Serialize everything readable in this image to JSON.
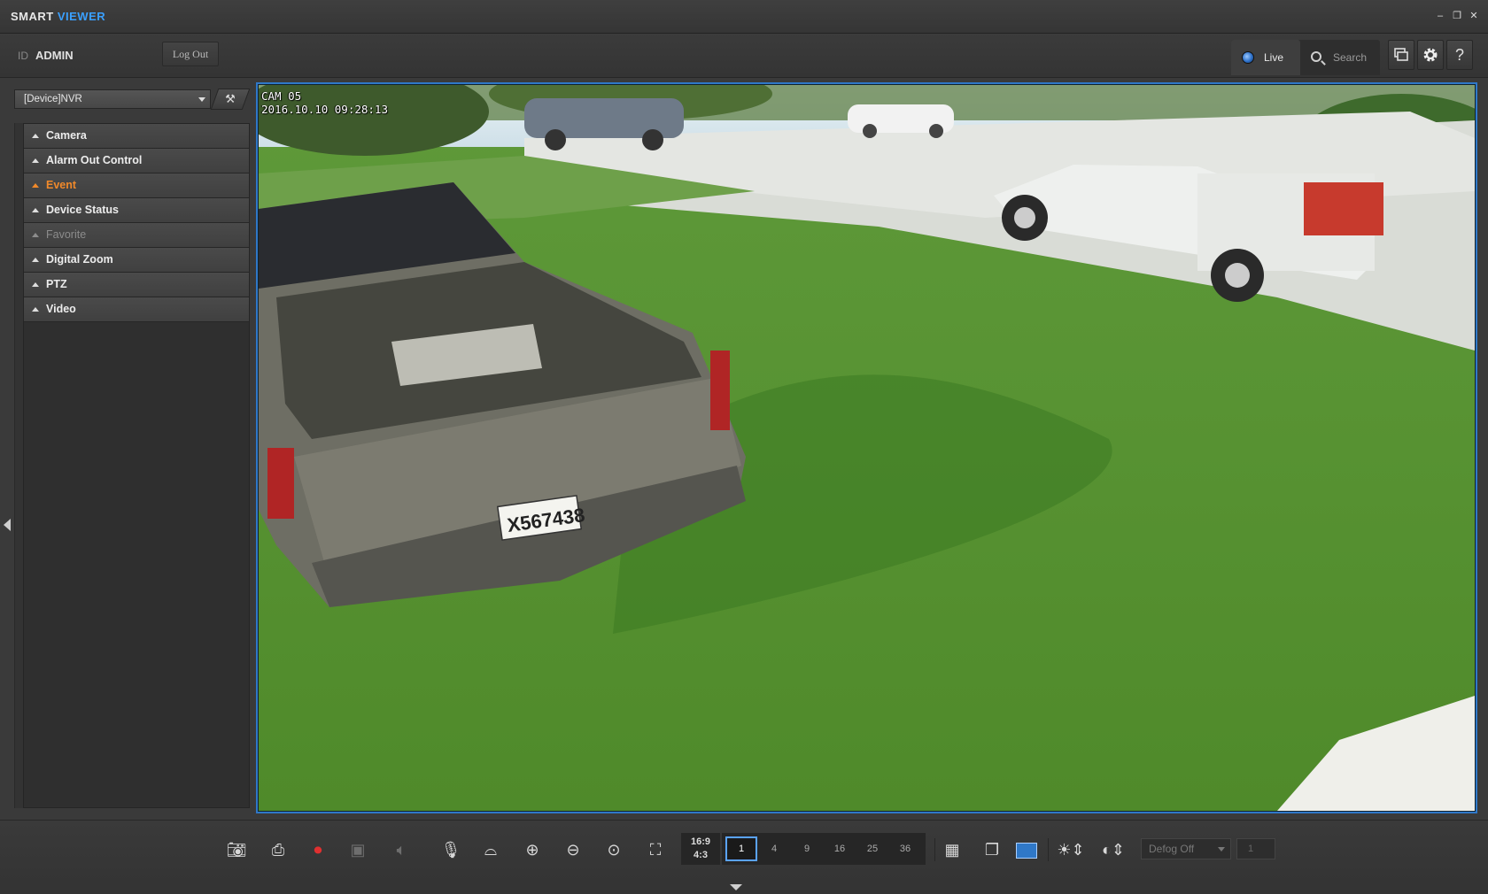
{
  "app": {
    "title_part1": "SMART",
    "title_part2": "VIEWER"
  },
  "window_controls": {
    "minimize": "–",
    "restore": "❐",
    "close": "✕"
  },
  "header": {
    "id_label": "ID",
    "user": "ADMIN",
    "logout_label": "Log Out",
    "tabs": {
      "live": "Live",
      "search": "Search"
    },
    "icons": [
      "display-icon",
      "gear-icon",
      "help-icon"
    ],
    "help_glyph": "?"
  },
  "left_panel": {
    "device": "[Device]NVR",
    "menu": [
      {
        "label": "Camera",
        "state": "normal"
      },
      {
        "label": "Alarm Out Control",
        "state": "normal"
      },
      {
        "label": "Event",
        "state": "active"
      },
      {
        "label": "Device Status",
        "state": "normal"
      },
      {
        "label": "Favorite",
        "state": "disabled"
      },
      {
        "label": "Digital Zoom",
        "state": "normal"
      },
      {
        "label": "PTZ",
        "state": "normal"
      },
      {
        "label": "Video",
        "state": "normal"
      }
    ]
  },
  "video": {
    "camera_name": "CAM 05",
    "timestamp": "2016.10.10 09:28:13",
    "plate_text": "X567438"
  },
  "toolbar": {
    "aspect_ratios": [
      "16:9",
      "4:3"
    ],
    "layouts": [
      "1",
      "4",
      "9",
      "16",
      "25",
      "36"
    ],
    "selected_layout": "1",
    "defog": "Defog Off",
    "defog_level": "1"
  },
  "colors": {
    "accent_blue": "#2f78c8",
    "active_orange": "#f0892a",
    "title_accent": "#3aa0ff"
  }
}
